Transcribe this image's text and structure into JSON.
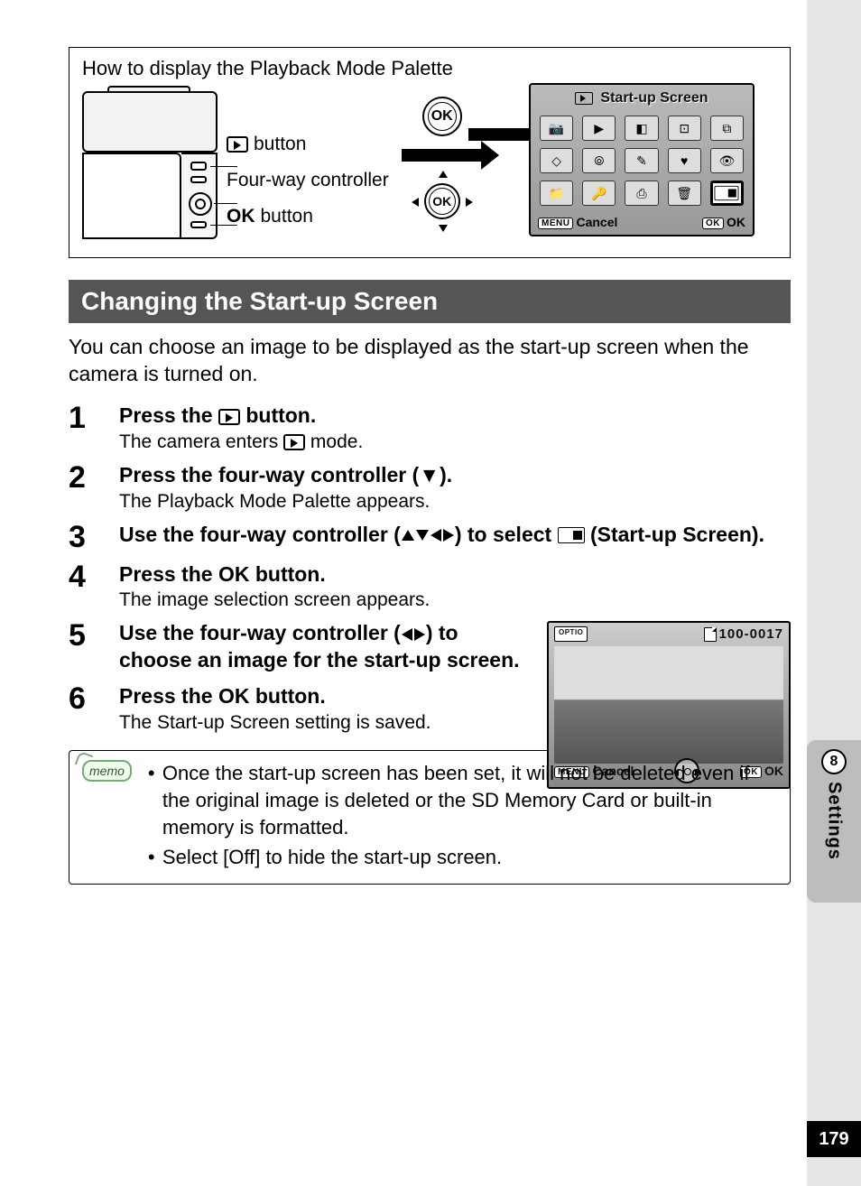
{
  "howto": {
    "title": "How to display the Playback Mode Palette",
    "callouts": {
      "playback_button_suffix": " button",
      "fourway": "Four-way controller",
      "ok_prefix": "OK",
      "ok_button_suffix": " button"
    },
    "ok_label": "OK",
    "lcd": {
      "title": "Start-up Screen",
      "footer_cancel_pill": "MENU",
      "footer_cancel": "Cancel",
      "footer_ok_pill": "OK",
      "footer_ok": "OK"
    }
  },
  "section_title": "Changing the Start-up Screen",
  "intro": "You can choose an image to be displayed as the start-up screen when the camera is turned on.",
  "steps": {
    "1": {
      "num": "1",
      "title_a": "Press the ",
      "title_b": " button.",
      "desc_a": "The camera enters ",
      "desc_b": " mode."
    },
    "2": {
      "num": "2",
      "title": "Press the four-way controller (▼).",
      "desc": "The Playback Mode Palette appears."
    },
    "3": {
      "num": "3",
      "title_a": "Use the four-way controller (",
      "title_b": ") to select ",
      "title_c": " (Start-up Screen)."
    },
    "4": {
      "num": "4",
      "title_a": "Press the ",
      "ok": "OK",
      "title_b": " button.",
      "desc": "The image selection screen appears."
    },
    "5": {
      "num": "5",
      "title_a": "Use the four-way controller (",
      "title_b": ") to choose an image for the start-up screen."
    },
    "6": {
      "num": "6",
      "title_a": "Press the ",
      "ok": "OK",
      "title_b": " button.",
      "desc": "The Start-up Screen setting is saved."
    }
  },
  "lcd2": {
    "optio": "OPTIO",
    "file_no": "100-0017",
    "footer_cancel_pill": "MENU",
    "footer_cancel": "Cancel",
    "footer_ok_pill": "OK",
    "footer_ok": "OK"
  },
  "memo": {
    "label": "memo",
    "items": [
      "Once the start-up screen has been set, it will not be deleted even if the original image is deleted or the SD Memory Card or built-in memory is formatted.",
      "Select [Off] to hide the start-up screen."
    ]
  },
  "sidebar": {
    "chapter": "8",
    "label": "Settings"
  },
  "page_number": "179"
}
